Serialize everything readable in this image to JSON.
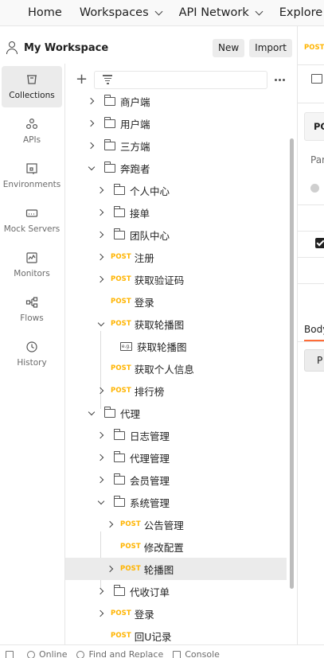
{
  "header": {
    "nav": [
      {
        "label": "Home",
        "has_chevron": false
      },
      {
        "label": "Workspaces",
        "has_chevron": true
      },
      {
        "label": "API Network",
        "has_chevron": true
      },
      {
        "label": "Explore",
        "has_chevron": false
      }
    ]
  },
  "workspace": {
    "title": "My Workspace",
    "new_label": "New",
    "import_label": "Import"
  },
  "sidebar": {
    "items": [
      {
        "label": "Collections",
        "icon": "collections-icon",
        "active": true
      },
      {
        "label": "APIs",
        "icon": "apis-icon",
        "active": false
      },
      {
        "label": "Environments",
        "icon": "environments-icon",
        "active": false
      },
      {
        "label": "Mock Servers",
        "icon": "mock-servers-icon",
        "active": false
      },
      {
        "label": "Monitors",
        "icon": "monitors-icon",
        "active": false
      },
      {
        "label": "Flows",
        "icon": "flows-icon",
        "active": false
      },
      {
        "label": "History",
        "icon": "history-icon",
        "active": false
      }
    ]
  },
  "tree": {
    "items": [
      {
        "label": "商户端",
        "type": "folder",
        "depth": 0,
        "caret": "right"
      },
      {
        "label": "用户端",
        "type": "folder",
        "depth": 0,
        "caret": "right"
      },
      {
        "label": "三方端",
        "type": "folder",
        "depth": 0,
        "caret": "right"
      },
      {
        "label": "奔跑者",
        "type": "folder",
        "depth": 0,
        "caret": "down"
      },
      {
        "label": "个人中心",
        "type": "folder",
        "depth": 1,
        "caret": "right"
      },
      {
        "label": "接单",
        "type": "folder",
        "depth": 1,
        "caret": "right"
      },
      {
        "label": "团队中心",
        "type": "folder",
        "depth": 1,
        "caret": "right"
      },
      {
        "label": "注册",
        "type": "request",
        "method": "POST",
        "depth": 1,
        "caret": "right"
      },
      {
        "label": "获取验证码",
        "type": "request",
        "method": "POST",
        "depth": 1,
        "caret": "right"
      },
      {
        "label": "登录",
        "type": "request",
        "method": "POST",
        "depth": 1,
        "caret": "none"
      },
      {
        "label": "获取轮播图",
        "type": "request",
        "method": "POST",
        "depth": 1,
        "caret": "down"
      },
      {
        "label": "获取轮播图",
        "type": "example",
        "depth": 2,
        "caret": "none"
      },
      {
        "label": "获取个人信息",
        "type": "request",
        "method": "POST",
        "depth": 1,
        "caret": "none"
      },
      {
        "label": "排行榜",
        "type": "request",
        "method": "POST",
        "depth": 1,
        "caret": "right"
      },
      {
        "label": "代理",
        "type": "folder",
        "depth": 0,
        "caret": "down"
      },
      {
        "label": "日志管理",
        "type": "folder",
        "depth": 1,
        "caret": "right"
      },
      {
        "label": "代理管理",
        "type": "folder",
        "depth": 1,
        "caret": "right"
      },
      {
        "label": "会员管理",
        "type": "folder",
        "depth": 1,
        "caret": "right"
      },
      {
        "label": "系统管理",
        "type": "folder",
        "depth": 1,
        "caret": "down"
      },
      {
        "label": "公告管理",
        "type": "request",
        "method": "POST",
        "depth": 2,
        "caret": "right"
      },
      {
        "label": "修改配置",
        "type": "request",
        "method": "POST",
        "depth": 2,
        "caret": "none"
      },
      {
        "label": "轮播图",
        "type": "request",
        "method": "POST",
        "depth": 2,
        "caret": "right",
        "selected": true
      },
      {
        "label": "代收订单",
        "type": "folder",
        "depth": 1,
        "caret": "right"
      },
      {
        "label": "登录",
        "type": "request",
        "method": "POST",
        "depth": 1,
        "caret": "right"
      },
      {
        "label": "回U记录",
        "type": "request",
        "method": "POST",
        "depth": 1,
        "caret": "none"
      }
    ]
  },
  "right_pane": {
    "tab_method": "POST",
    "method_label": "PO",
    "params_label": "Par",
    "body_label": "Body",
    "button_label": "P"
  },
  "statusbar": {
    "online": "Online",
    "find_replace": "Find and Replace",
    "console": "Console"
  },
  "colors": {
    "post": "#ffb400",
    "accent": "#ff6c37",
    "selected_row": "#ebebeb"
  }
}
